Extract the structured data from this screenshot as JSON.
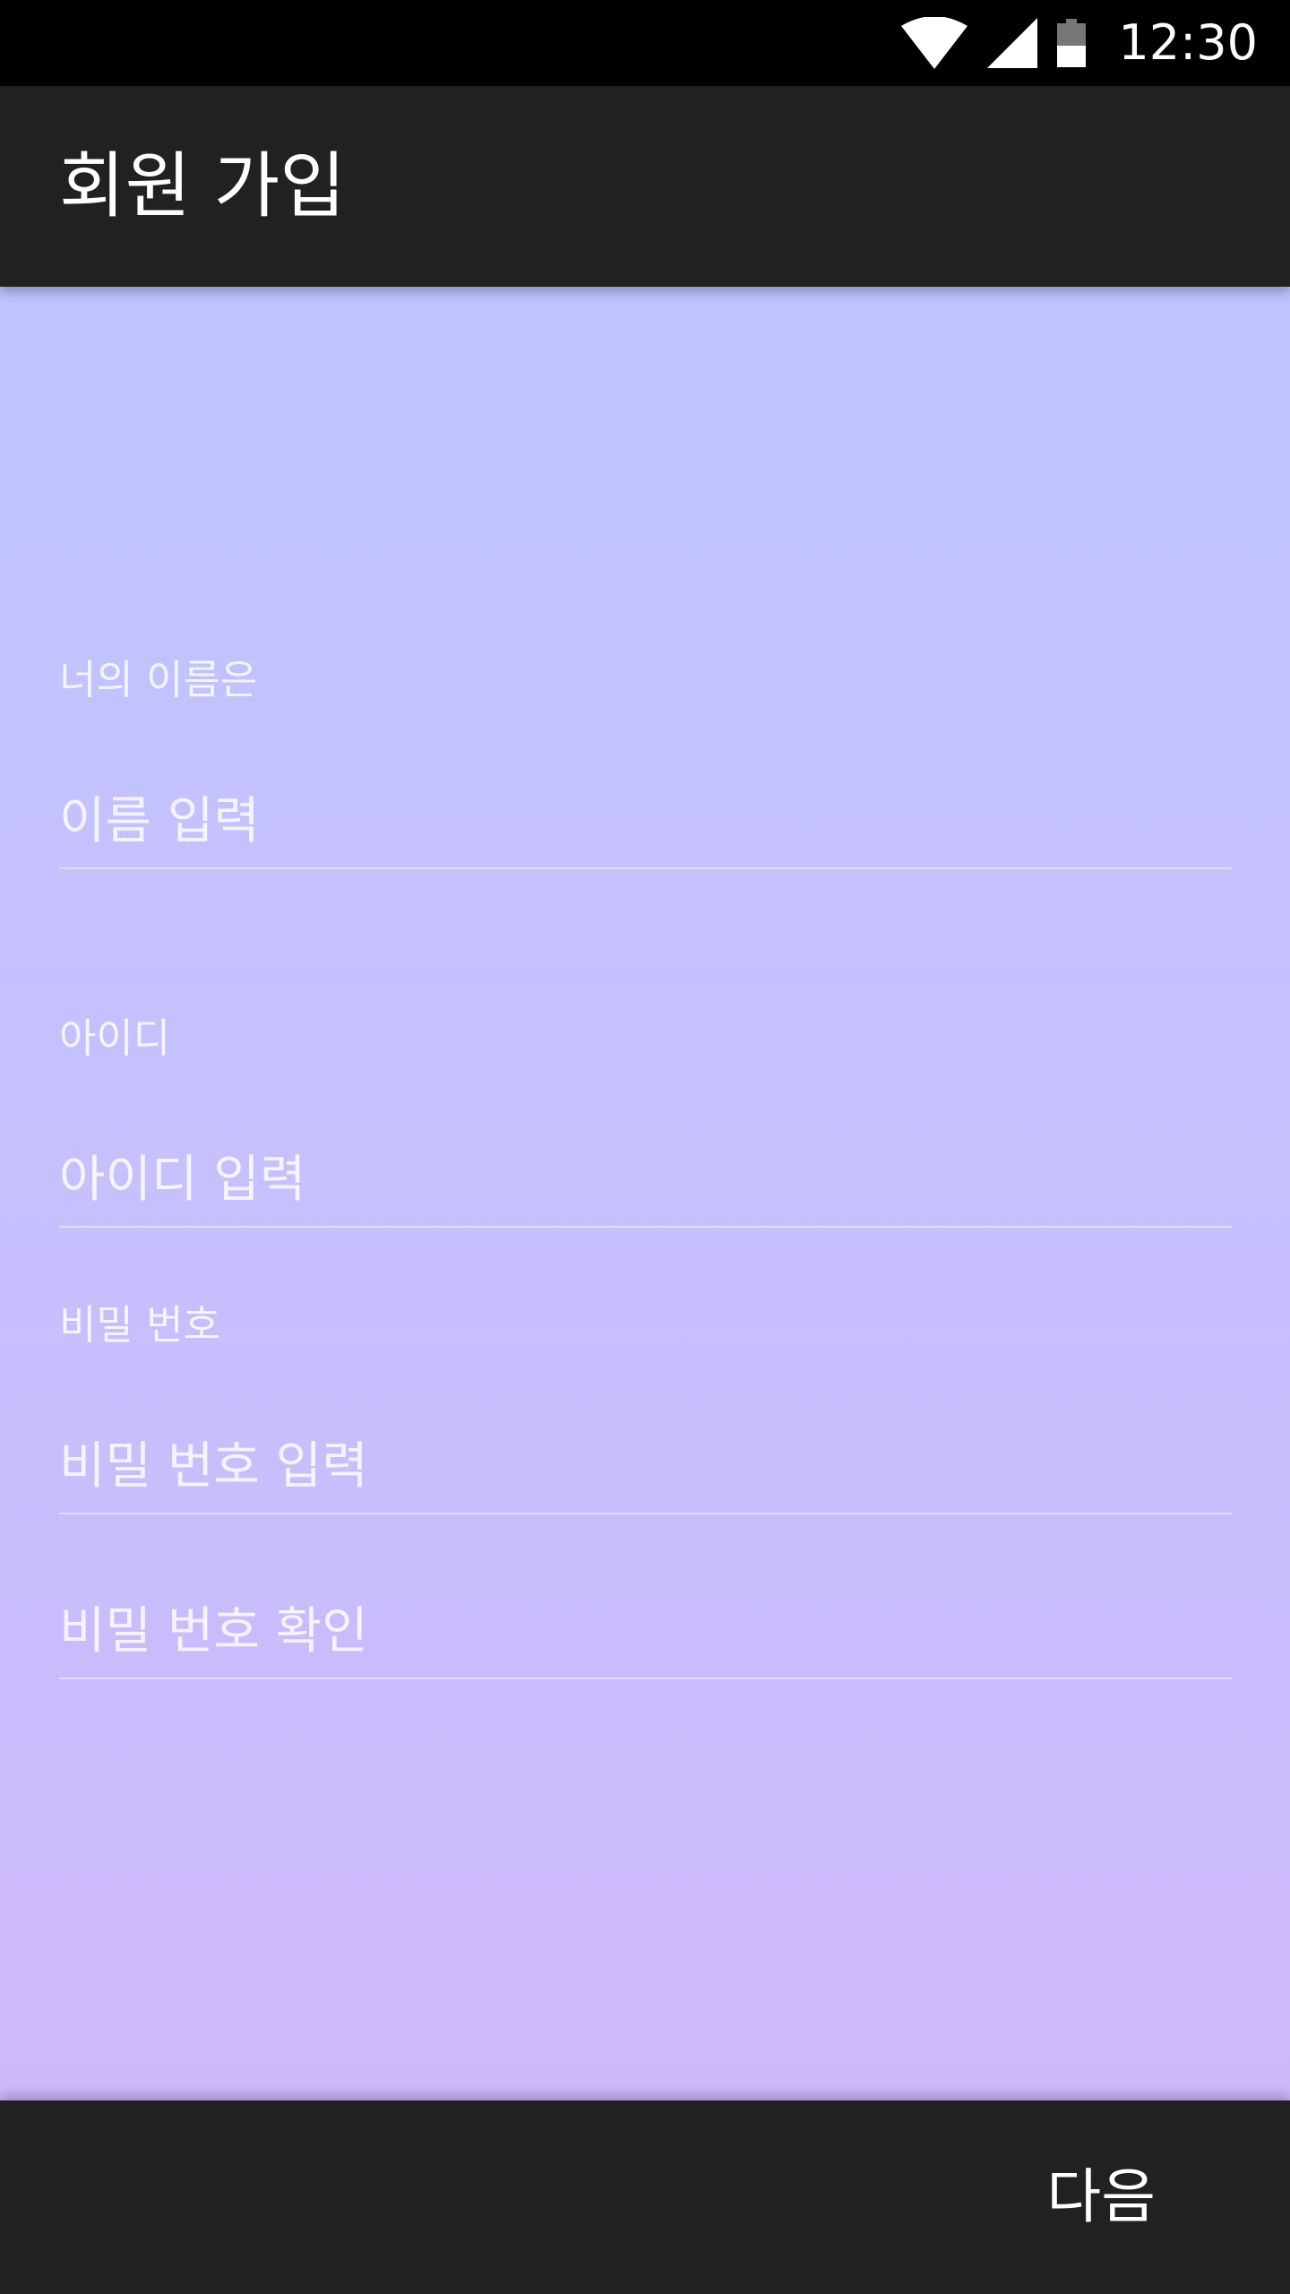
{
  "status_bar": {
    "time": "12:30",
    "icons": [
      "wifi-icon",
      "cellular-signal-icon",
      "battery-icon"
    ]
  },
  "app_bar": {
    "title": "회원 가입"
  },
  "form": {
    "name": {
      "label": "너의 이름은",
      "placeholder": "이름 입력",
      "value": ""
    },
    "user_id": {
      "label": "아이디",
      "placeholder": "아이디 입력",
      "value": ""
    },
    "password": {
      "label": "비밀 번호",
      "placeholder": "비밀 번호 입력",
      "value": ""
    },
    "password_confirm": {
      "placeholder": "비밀 번호 확인",
      "value": ""
    }
  },
  "bottom_bar": {
    "next_label": "다음"
  },
  "colors": {
    "app_bar": "#212121",
    "content_gradient_top": "#bfc4ff",
    "content_gradient_bottom": "#cdb9fa"
  }
}
